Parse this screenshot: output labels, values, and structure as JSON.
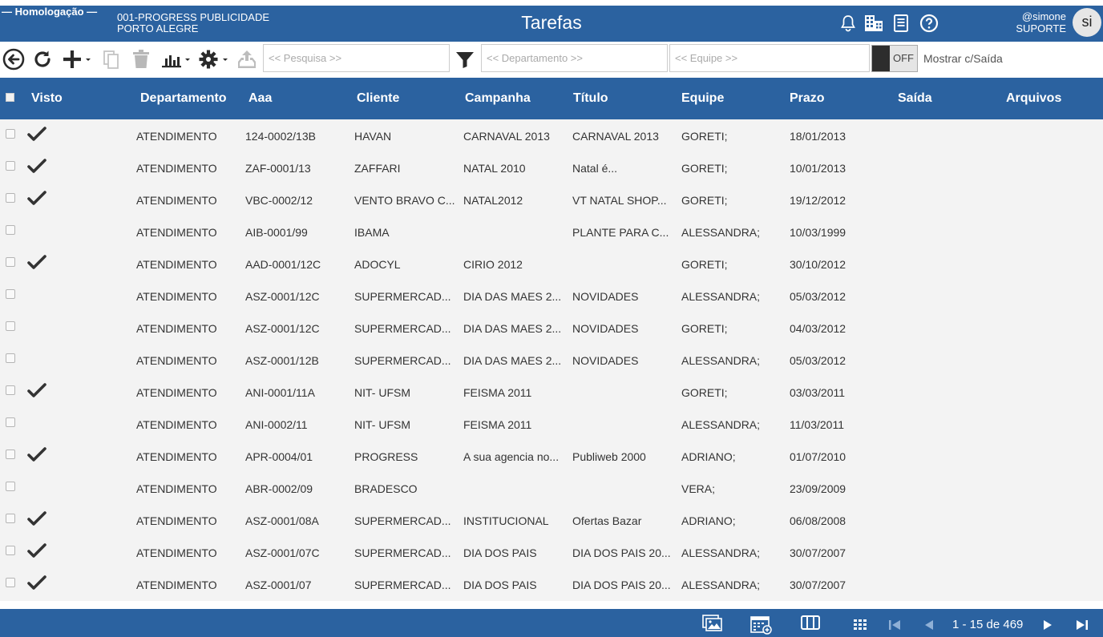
{
  "header": {
    "environment": "— Homologação —",
    "company_line1": "001-PROGRESS PUBLICIDADE",
    "company_line2": "PORTO ALEGRE",
    "title": "Tarefas",
    "user_handle": "@simone",
    "user_role": "SUPORTE",
    "avatar_initials": "si",
    "icons": [
      "bell-icon",
      "building-icon",
      "document-icon",
      "help-icon"
    ]
  },
  "toolbar": {
    "search_placeholder": "<< Pesquisa >>",
    "department_placeholder": "<< Departamento >>",
    "team_placeholder": "<< Equipe >>",
    "toggle_state": "OFF",
    "toggle_label": "Mostrar c/Saída"
  },
  "table": {
    "columns": [
      "Visto",
      "Departamento",
      "Aaa",
      "Cliente",
      "Campanha",
      "Título",
      "Equipe",
      "Prazo",
      "Saída",
      "Arquivos"
    ],
    "rows": [
      {
        "visto": true,
        "departamento": "ATENDIMENTO",
        "aaa": "124-0002/13B",
        "cliente": "HAVAN",
        "campanha": "CARNAVAL 2013",
        "titulo": "CARNAVAL 2013",
        "equipe": "GORETI;",
        "prazo": "18/01/2013"
      },
      {
        "visto": true,
        "departamento": "ATENDIMENTO",
        "aaa": "ZAF-0001/13",
        "cliente": "ZAFFARI",
        "campanha": "NATAL 2010",
        "titulo": "Natal é...",
        "equipe": "GORETI;",
        "prazo": "10/01/2013"
      },
      {
        "visto": true,
        "departamento": "ATENDIMENTO",
        "aaa": "VBC-0002/12",
        "cliente": "VENTO BRAVO C...",
        "campanha": "NATAL2012",
        "titulo": "VT NATAL SHOP...",
        "equipe": "GORETI;",
        "prazo": "19/12/2012"
      },
      {
        "visto": false,
        "departamento": "ATENDIMENTO",
        "aaa": "AIB-0001/99",
        "cliente": "IBAMA",
        "campanha": "",
        "titulo": "PLANTE PARA C...",
        "equipe": "ALESSANDRA;",
        "prazo": "10/03/1999"
      },
      {
        "visto": true,
        "departamento": "ATENDIMENTO",
        "aaa": "AAD-0001/12C",
        "cliente": "ADOCYL",
        "campanha": "CIRIO 2012",
        "titulo": "",
        "equipe": "GORETI;",
        "prazo": "30/10/2012"
      },
      {
        "visto": false,
        "departamento": "ATENDIMENTO",
        "aaa": "ASZ-0001/12C",
        "cliente": "SUPERMERCAD...",
        "campanha": "DIA DAS MAES 2...",
        "titulo": "NOVIDADES",
        "equipe": "ALESSANDRA;",
        "prazo": "05/03/2012"
      },
      {
        "visto": false,
        "departamento": "ATENDIMENTO",
        "aaa": "ASZ-0001/12C",
        "cliente": "SUPERMERCAD...",
        "campanha": "DIA DAS MAES 2...",
        "titulo": "NOVIDADES",
        "equipe": "GORETI;",
        "prazo": "04/03/2012"
      },
      {
        "visto": false,
        "departamento": "ATENDIMENTO",
        "aaa": "ASZ-0001/12B",
        "cliente": "SUPERMERCAD...",
        "campanha": "DIA DAS MAES 2...",
        "titulo": "NOVIDADES",
        "equipe": "ALESSANDRA;",
        "prazo": "05/03/2012"
      },
      {
        "visto": true,
        "departamento": "ATENDIMENTO",
        "aaa": "ANI-0001/11A",
        "cliente": "NIT- UFSM",
        "campanha": "FEISMA 2011",
        "titulo": "",
        "equipe": "GORETI;",
        "prazo": "03/03/2011"
      },
      {
        "visto": false,
        "departamento": "ATENDIMENTO",
        "aaa": "ANI-0002/11",
        "cliente": "NIT- UFSM",
        "campanha": "FEISMA 2011",
        "titulo": "",
        "equipe": "ALESSANDRA;",
        "prazo": "11/03/2011"
      },
      {
        "visto": true,
        "departamento": "ATENDIMENTO",
        "aaa": "APR-0004/01",
        "cliente": "PROGRESS",
        "campanha": "A sua agencia no...",
        "titulo": "Publiweb 2000",
        "equipe": "ADRIANO;",
        "prazo": "01/07/2010"
      },
      {
        "visto": false,
        "departamento": "ATENDIMENTO",
        "aaa": "ABR-0002/09",
        "cliente": "BRADESCO",
        "campanha": "",
        "titulo": "",
        "equipe": "VERA;",
        "prazo": "23/09/2009"
      },
      {
        "visto": true,
        "departamento": "ATENDIMENTO",
        "aaa": "ASZ-0001/08A",
        "cliente": "SUPERMERCAD...",
        "campanha": "INSTITUCIONAL",
        "titulo": "Ofertas Bazar",
        "equipe": "ADRIANO;",
        "prazo": "06/08/2008"
      },
      {
        "visto": true,
        "departamento": "ATENDIMENTO",
        "aaa": "ASZ-0001/07C",
        "cliente": "SUPERMERCAD...",
        "campanha": "DIA DOS PAIS",
        "titulo": "DIA DOS PAIS 20...",
        "equipe": "ALESSANDRA;",
        "prazo": "30/07/2007"
      },
      {
        "visto": true,
        "departamento": "ATENDIMENTO",
        "aaa": "ASZ-0001/07",
        "cliente": "SUPERMERCAD...",
        "campanha": "DIA DOS PAIS",
        "titulo": "DIA DOS PAIS 20...",
        "equipe": "ALESSANDRA;",
        "prazo": "30/07/2007"
      }
    ]
  },
  "footer": {
    "pager_text": "1 - 15 de 469"
  },
  "colors": {
    "primary": "#2b62a0",
    "row_background": "#f3f3f3",
    "check": "#333333"
  }
}
